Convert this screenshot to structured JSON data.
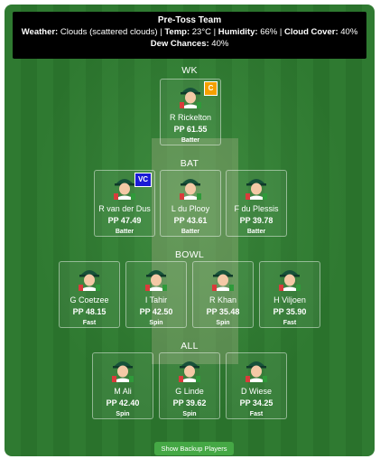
{
  "header": {
    "title": "Pre-Toss Team",
    "weather_label": "Weather:",
    "weather_value": " Clouds (scattered clouds) | ",
    "temp_label": "Temp:",
    "temp_value": " 23°C | ",
    "humidity_label": "Humidity:",
    "humidity_value": " 66% | ",
    "cloud_label": "Cloud Cover:",
    "cloud_value": " 40%",
    "dew_label": "Dew Chances:",
    "dew_value": " 40%"
  },
  "sections": {
    "wk": "WK",
    "bat": "BAT",
    "bowl": "BOWL",
    "all": "ALL"
  },
  "players": {
    "wk": [
      {
        "name": "R Rickelton",
        "pp": "PP 61.55",
        "role": "Batter",
        "badge": "C",
        "badge_color": "#f5a000"
      }
    ],
    "bat": [
      {
        "name": "R van der Dus",
        "pp": "PP 47.49",
        "role": "Batter",
        "badge": "VC",
        "badge_color": "#1b1bd6"
      },
      {
        "name": "L du Plooy",
        "pp": "PP 43.61",
        "role": "Batter"
      },
      {
        "name": "F du Plessis",
        "pp": "PP 39.78",
        "role": "Batter"
      }
    ],
    "bowl": [
      {
        "name": "G Coetzee",
        "pp": "PP 48.15",
        "role": "Fast"
      },
      {
        "name": "I Tahir",
        "pp": "PP 42.50",
        "role": "Spin"
      },
      {
        "name": "R Khan",
        "pp": "PP 35.48",
        "role": "Spin"
      },
      {
        "name": "H Viljoen",
        "pp": "PP 35.90",
        "role": "Fast"
      }
    ],
    "all": [
      {
        "name": "M Ali",
        "pp": "PP 42.40",
        "role": "Spin"
      },
      {
        "name": "G Linde",
        "pp": "PP 39.62",
        "role": "Spin"
      },
      {
        "name": "D Wiese",
        "pp": "PP 34.25",
        "role": "Fast"
      }
    ]
  },
  "footer": {
    "backup_button": "Show Backup Players"
  },
  "colors": {
    "field": "#2f7a31",
    "button": "#45a845",
    "captain_badge": "#f5a000",
    "vice_captain_badge": "#1b1bd6"
  }
}
